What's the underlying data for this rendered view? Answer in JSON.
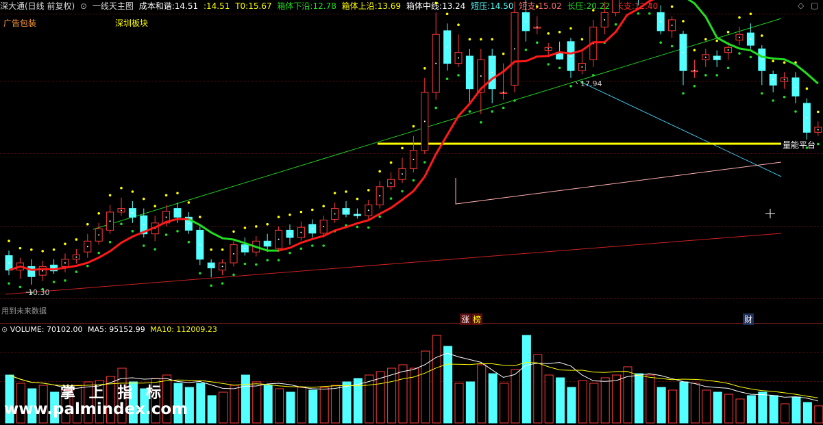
{
  "header": {
    "instrument": "深大通(日线 前复权)",
    "indicator_name": "一线天主图",
    "cost": {
      "label": "成本和谐:",
      "value": "14.51"
    },
    "cost2": {
      "label": ":",
      "value": "14.51"
    },
    "t0": {
      "label": "T0:",
      "value": "15.67"
    },
    "box_low": {
      "label": "箱体下沿:",
      "value": "12.78"
    },
    "box_high": {
      "label": "箱体上沿:",
      "value": "13.69"
    },
    "box_mid": {
      "label": "箱体中线:",
      "value": "13.24"
    },
    "short_press": {
      "label": "短压:",
      "value": "14.50"
    },
    "short_support": {
      "label": "短支:",
      "value": "15.02"
    },
    "long_press": {
      "label": "长压:",
      "value": "20.22"
    },
    "long_support": {
      "label": "长支:",
      "value": "12.40"
    }
  },
  "sublabels": {
    "ad": "广告包装",
    "sector": "深圳板块"
  },
  "chart_labels": {
    "high": "17.94",
    "low": "10.30",
    "platform": "量能平台",
    "future_data": "用到未来数据",
    "tag_zhang": "涨",
    "tag_bang": "榜",
    "tag_cai": "财"
  },
  "volume_header": {
    "title": "VOLUME: 70102.00",
    "ma5": "MA5: 95152.99",
    "ma10": "MA10: 112009.23"
  },
  "watermark": {
    "chars": "掌 上 指 标",
    "url": "www.palmindex.com"
  },
  "colors": {
    "up": "#ff3b3b",
    "down": "#54ffff",
    "ma_red": "#ff1a1a",
    "ma_green": "#22dd22",
    "yellow": "#ffff00",
    "cyan_line": "#3fc6e8"
  },
  "chart_data": {
    "type": "candlestick",
    "series": [
      {
        "name": "",
        "values": [
          [
            12.25,
            12.05,
            12.32,
            11.98
          ],
          [
            12.05,
            12.15,
            12.22,
            11.93
          ],
          [
            12.1,
            11.96,
            12.2,
            11.85
          ],
          [
            11.98,
            12.1,
            12.18,
            11.9
          ],
          [
            12.12,
            12.04,
            12.2,
            12.0
          ],
          [
            12.1,
            12.2,
            12.28,
            12.02
          ],
          [
            12.2,
            12.26,
            12.34,
            12.14
          ],
          [
            12.3,
            12.45,
            12.55,
            12.22
          ],
          [
            12.45,
            12.62,
            12.7,
            12.4
          ],
          [
            12.6,
            12.85,
            12.95,
            12.55
          ],
          [
            12.85,
            12.9,
            13.05,
            12.8
          ],
          [
            12.9,
            12.78,
            13.0,
            12.7
          ],
          [
            12.8,
            12.55,
            12.9,
            12.5
          ],
          [
            12.55,
            12.7,
            12.8,
            12.45
          ],
          [
            12.7,
            12.86,
            12.95,
            12.65
          ],
          [
            12.9,
            12.78,
            12.98,
            12.7
          ],
          [
            12.78,
            12.6,
            12.85,
            12.55
          ],
          [
            12.6,
            12.2,
            12.65,
            12.12
          ],
          [
            12.15,
            12.08,
            12.2,
            11.95
          ],
          [
            12.05,
            12.15,
            12.2,
            11.98
          ],
          [
            12.15,
            12.4,
            12.45,
            12.1
          ],
          [
            12.4,
            12.3,
            12.5,
            12.25
          ],
          [
            12.3,
            12.45,
            12.52,
            12.24
          ],
          [
            12.45,
            12.38,
            12.55,
            12.3
          ],
          [
            12.35,
            12.6,
            12.65,
            12.3
          ],
          [
            12.6,
            12.5,
            12.68,
            12.4
          ],
          [
            12.5,
            12.64,
            12.72,
            12.46
          ],
          [
            12.68,
            12.56,
            12.75,
            12.5
          ],
          [
            12.56,
            12.74,
            12.8,
            12.5
          ],
          [
            12.75,
            12.9,
            12.98,
            12.7
          ],
          [
            12.9,
            12.82,
            13.0,
            12.78
          ],
          [
            12.82,
            12.8,
            12.9,
            12.76
          ],
          [
            12.8,
            12.95,
            13.02,
            12.75
          ],
          [
            12.95,
            13.2,
            13.28,
            12.9
          ],
          [
            13.2,
            13.3,
            13.4,
            13.15
          ],
          [
            13.3,
            13.45,
            13.6,
            13.25
          ],
          [
            13.45,
            13.7,
            13.9,
            13.4
          ],
          [
            13.7,
            14.5,
            14.7,
            13.65
          ],
          [
            14.5,
            15.3,
            15.6,
            14.4
          ],
          [
            15.35,
            14.9,
            15.45,
            14.8
          ],
          [
            14.9,
            15.05,
            15.3,
            14.85
          ],
          [
            15.0,
            14.55,
            15.1,
            14.35
          ],
          [
            14.5,
            14.95,
            15.1,
            14.2
          ],
          [
            15.0,
            14.55,
            15.1,
            14.35
          ],
          [
            14.5,
            14.5,
            14.9,
            14.4
          ],
          [
            14.6,
            15.6,
            15.75,
            14.5
          ],
          [
            15.6,
            15.35,
            16.6,
            15.2
          ],
          [
            15.4,
            15.4,
            15.55,
            15.3
          ],
          [
            15.08,
            15.12,
            15.18,
            15.0
          ],
          [
            15.05,
            14.96,
            15.2,
            14.95
          ],
          [
            15.2,
            14.8,
            15.25,
            14.7
          ],
          [
            14.8,
            14.9,
            15.1,
            14.75
          ],
          [
            14.95,
            15.4,
            15.5,
            14.85
          ],
          [
            15.4,
            15.6,
            15.75,
            15.3
          ],
          [
            15.6,
            16.5,
            16.6,
            15.55
          ],
          [
            16.4,
            17.25,
            17.94,
            16.2
          ],
          [
            15.83,
            15.8,
            15.9,
            15.7
          ],
          [
            15.78,
            15.82,
            15.92,
            15.7
          ],
          [
            15.6,
            15.35,
            15.7,
            15.3
          ],
          [
            15.35,
            15.5,
            15.55,
            15.25
          ],
          [
            15.3,
            14.8,
            15.35,
            14.6
          ],
          [
            14.8,
            14.8,
            14.95,
            14.7
          ],
          [
            14.95,
            15.02,
            15.1,
            14.85
          ],
          [
            15.0,
            14.95,
            15.08,
            14.85
          ],
          [
            15.05,
            15.12,
            15.2,
            14.95
          ],
          [
            15.22,
            15.3,
            15.4,
            15.15
          ],
          [
            15.32,
            15.15,
            15.45,
            15.1
          ],
          [
            15.1,
            14.8,
            15.15,
            14.6
          ],
          [
            14.75,
            14.6,
            14.8,
            14.5
          ],
          [
            14.65,
            14.7,
            14.78,
            14.55
          ],
          [
            14.7,
            14.45,
            14.78,
            14.35
          ],
          [
            14.35,
            13.95,
            14.42,
            13.85
          ],
          [
            13.95,
            14.02,
            14.1,
            13.9
          ]
        ]
      },
      {
        "name": "",
        "values": [
          70,
          58,
          50,
          55,
          45,
          48,
          55,
          60,
          62,
          68,
          80,
          60,
          50,
          65,
          70,
          58,
          52,
          58,
          40,
          45,
          55,
          70,
          60,
          55,
          50,
          45,
          52,
          48,
          52,
          55,
          60,
          65,
          70,
          75,
          80,
          85,
          80,
          105,
          128,
          112,
          58,
          60,
          85,
          72,
          58,
          78,
          128,
          100,
          70,
          66,
          52,
          62,
          58,
          66,
          70,
          82,
          72,
          70,
          52,
          48,
          60,
          58,
          48,
          45,
          42,
          35,
          40,
          45,
          40,
          28,
          38,
          30,
          25
        ]
      }
    ]
  }
}
